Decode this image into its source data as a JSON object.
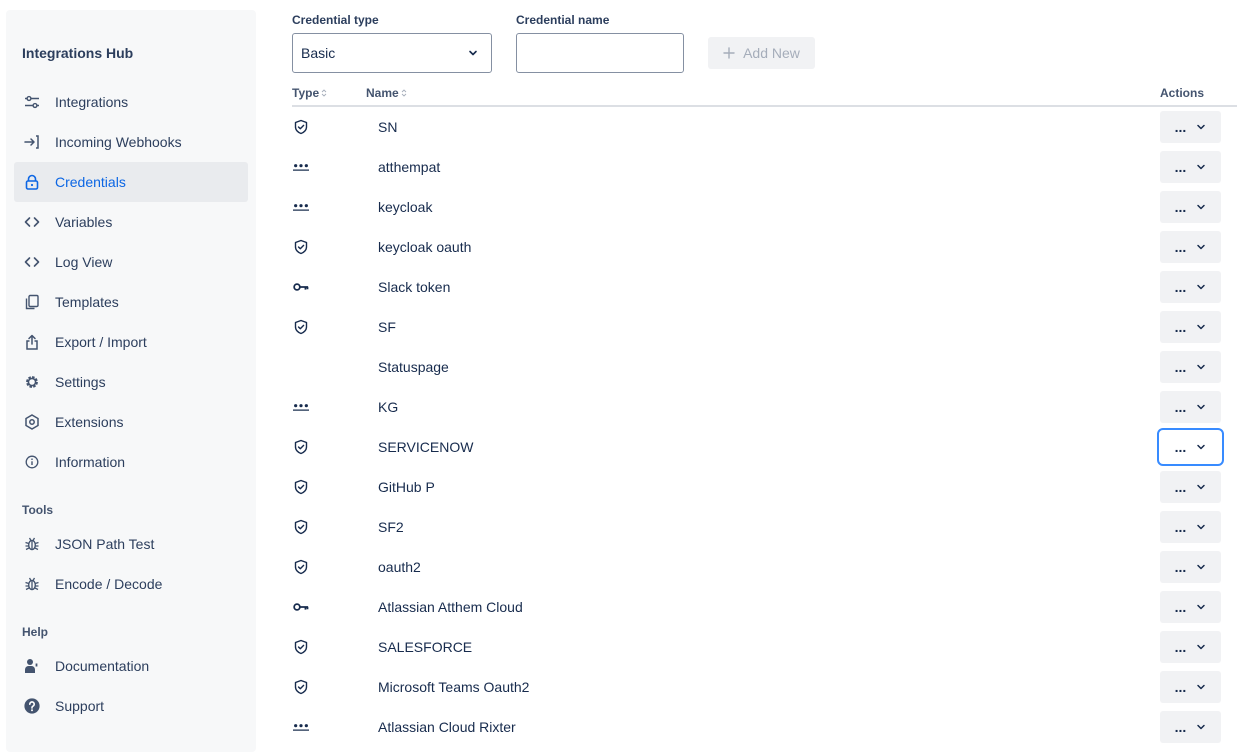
{
  "sidebar": {
    "title": "Integrations Hub",
    "items": [
      {
        "label": "Integrations",
        "icon": "sliders-icon"
      },
      {
        "label": "Incoming Webhooks",
        "icon": "sign-in-icon"
      },
      {
        "label": "Credentials",
        "icon": "lock-icon"
      },
      {
        "label": "Variables",
        "icon": "code-icon"
      },
      {
        "label": "Log View",
        "icon": "code-icon"
      },
      {
        "label": "Templates",
        "icon": "copy-icon"
      },
      {
        "label": "Export / Import",
        "icon": "export-icon"
      },
      {
        "label": "Settings",
        "icon": "gear-icon"
      },
      {
        "label": "Extensions",
        "icon": "hexagon-icon"
      },
      {
        "label": "Information",
        "icon": "info-icon"
      }
    ],
    "tools_label": "Tools",
    "tools": [
      {
        "label": "JSON Path Test",
        "icon": "bug-icon"
      },
      {
        "label": "Encode / Decode",
        "icon": "bug-icon"
      }
    ],
    "help_label": "Help",
    "help": [
      {
        "label": "Documentation",
        "icon": "person-icon"
      },
      {
        "label": "Support",
        "icon": "question-icon"
      }
    ],
    "active": "Credentials"
  },
  "filters": {
    "type_label": "Credential type",
    "type_value": "Basic",
    "name_label": "Credential name",
    "name_value": "",
    "add_label": "Add New"
  },
  "table": {
    "headers": {
      "type": "Type",
      "name": "Name",
      "actions": "Actions"
    },
    "action_label": "...",
    "rows": [
      {
        "type": "shield-icon",
        "name": "SN"
      },
      {
        "type": "dots-icon",
        "name": "atthempat"
      },
      {
        "type": "dots-icon",
        "name": "keycloak"
      },
      {
        "type": "shield-icon",
        "name": "keycloak oauth"
      },
      {
        "type": "key-icon",
        "name": "Slack token"
      },
      {
        "type": "shield-icon",
        "name": "SF"
      },
      {
        "type": "none",
        "name": "Statuspage"
      },
      {
        "type": "dots-icon",
        "name": "KG"
      },
      {
        "type": "shield-icon",
        "name": "SERVICENOW"
      },
      {
        "type": "shield-icon",
        "name": "GitHub P"
      },
      {
        "type": "shield-icon",
        "name": "SF2"
      },
      {
        "type": "shield-icon",
        "name": "oauth2"
      },
      {
        "type": "key-icon",
        "name": "Atlassian Atthem Cloud"
      },
      {
        "type": "shield-icon",
        "name": "SALESFORCE"
      },
      {
        "type": "shield-icon",
        "name": "Microsoft Teams Oauth2"
      },
      {
        "type": "dots-icon",
        "name": "Atlassian Cloud Rixter"
      }
    ],
    "focused_row": 8
  }
}
